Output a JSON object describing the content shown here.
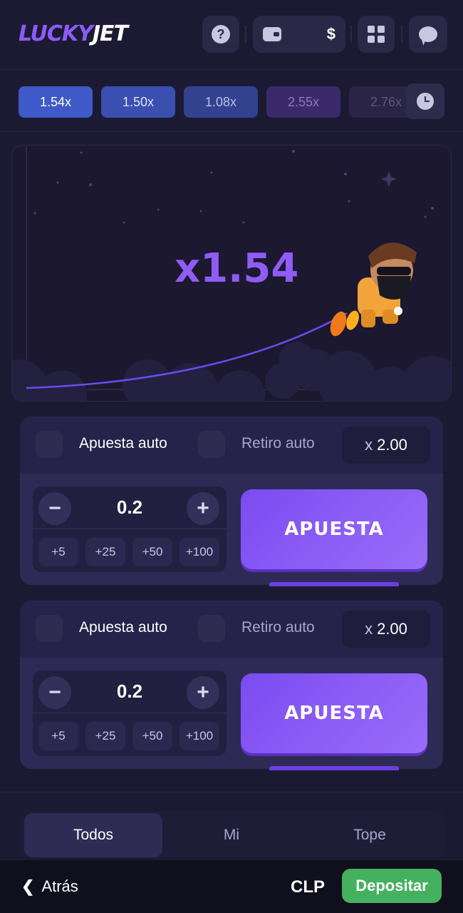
{
  "header": {
    "logo_part1": "LUCKY",
    "logo_part2": "JET",
    "help_label": "?",
    "currency_symbol": "$"
  },
  "history": {
    "items": [
      {
        "value": "1.54x",
        "color": "#4059c8"
      },
      {
        "value": "1.50x",
        "color": "#3a4fb0"
      },
      {
        "value": "1.08x",
        "color": "#33428e"
      },
      {
        "value": "2.55x",
        "color": "#3b2a6a"
      },
      {
        "value": "2.76x",
        "color": "#2a2546"
      }
    ]
  },
  "game": {
    "multiplier": "x1.54"
  },
  "panels": [
    {
      "auto_bet_label": "Apuesta auto",
      "auto_cashout_label": "Retiro auto",
      "cashout_prefix": "x",
      "cashout_value": "2.00",
      "stake_value": "0.2",
      "minus": "−",
      "plus": "+",
      "quick": [
        "+5",
        "+25",
        "+50",
        "+100"
      ],
      "bet_label": "APUESTA"
    },
    {
      "auto_bet_label": "Apuesta auto",
      "auto_cashout_label": "Retiro auto",
      "cashout_prefix": "x",
      "cashout_value": "2.00",
      "stake_value": "0.2",
      "minus": "−",
      "plus": "+",
      "quick": [
        "+5",
        "+25",
        "+50",
        "+100"
      ],
      "bet_label": "APUESTA"
    }
  ],
  "tabs": [
    "Todos",
    "Mi",
    "Tope"
  ],
  "footer": {
    "back_label": "Atrás",
    "currency": "CLP",
    "deposit_label": "Depositar"
  },
  "colors": {
    "accent": "#8b5cf6",
    "deposit": "#45b15f",
    "background": "#1c1a33"
  }
}
